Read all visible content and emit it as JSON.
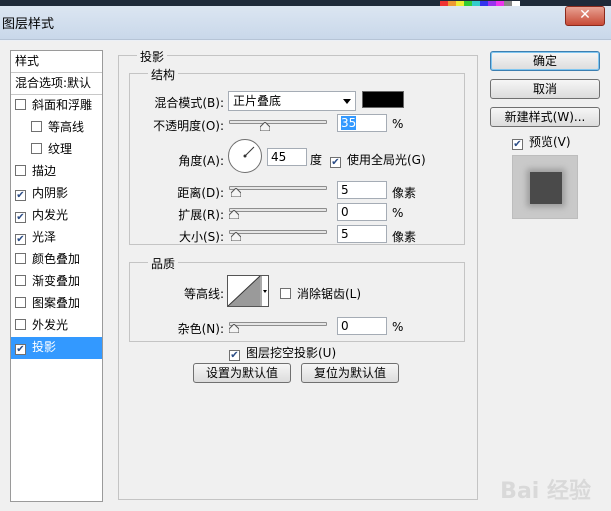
{
  "window": {
    "title": "图层样式",
    "close_glyph": "✕"
  },
  "colors": {
    "accent": "#3399ff",
    "shadow_color": "#000000"
  },
  "style_list": {
    "header": "样式",
    "blend_options": "混合选项:默认",
    "items": [
      {
        "label": "斜面和浮雕",
        "checked": false,
        "indent": false
      },
      {
        "label": "等高线",
        "checked": false,
        "indent": true
      },
      {
        "label": "纹理",
        "checked": false,
        "indent": true
      },
      {
        "label": "描边",
        "checked": false,
        "indent": false
      },
      {
        "label": "内阴影",
        "checked": true,
        "indent": false
      },
      {
        "label": "内发光",
        "checked": true,
        "indent": false
      },
      {
        "label": "光泽",
        "checked": true,
        "indent": false
      },
      {
        "label": "颜色叠加",
        "checked": false,
        "indent": false
      },
      {
        "label": "渐变叠加",
        "checked": false,
        "indent": false
      },
      {
        "label": "图案叠加",
        "checked": false,
        "indent": false
      },
      {
        "label": "外发光",
        "checked": false,
        "indent": false
      },
      {
        "label": "投影",
        "checked": true,
        "indent": false,
        "active": true
      }
    ]
  },
  "drop_shadow": {
    "title": "投影",
    "structure": {
      "title": "结构",
      "blend_mode_label": "混合模式(B):",
      "blend_mode_value": "正片叠底",
      "opacity_label": "不透明度(O):",
      "opacity_value": "35",
      "opacity_unit": "%",
      "opacity_level": 0.35,
      "angle_label": "角度(A):",
      "angle_value": "45",
      "angle_unit": "度",
      "global_light_label": "使用全局光(G)",
      "global_light_checked": true,
      "distance_label": "距离(D):",
      "distance_value": "5",
      "distance_unit": "像素",
      "distance_level": 0.02,
      "spread_label": "扩展(R):",
      "spread_value": "0",
      "spread_unit": "%",
      "spread_level": 0.0,
      "size_label": "大小(S):",
      "size_value": "5",
      "size_unit": "像素",
      "size_level": 0.02
    },
    "quality": {
      "title": "品质",
      "contour_label": "等高线:",
      "anti_alias_label": "消除锯齿(L)",
      "anti_alias_checked": false,
      "noise_label": "杂色(N):",
      "noise_value": "0",
      "noise_unit": "%",
      "noise_level": 0.0
    },
    "knockout_label": "图层挖空投影(U)",
    "knockout_checked": true,
    "make_default_label": "设置为默认值",
    "reset_default_label": "复位为默认值"
  },
  "buttons": {
    "ok": "确定",
    "cancel": "取消",
    "new_style": "新建样式(W)...",
    "preview_label": "预览(V)",
    "preview_checked": true
  },
  "watermark": "Bai 经验"
}
